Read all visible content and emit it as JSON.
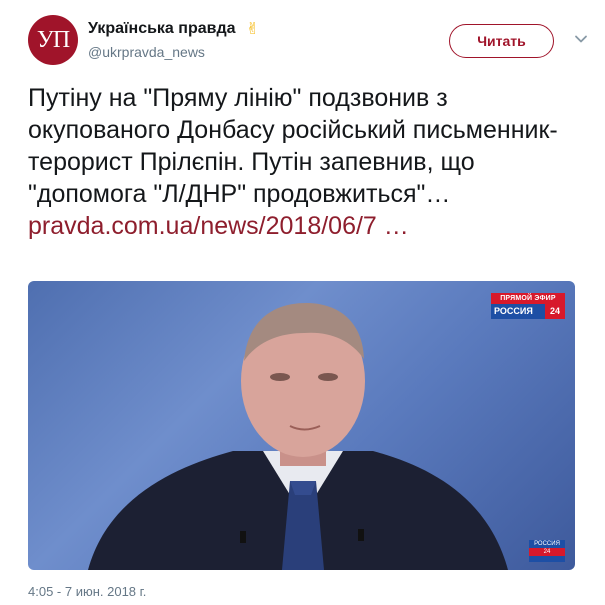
{
  "account": {
    "avatar_text": "УП",
    "display_name": "Українська правда",
    "victory_emoji": "✌",
    "handle": "@ukrpravda_news"
  },
  "follow_button": {
    "label": "Читать"
  },
  "tweet": {
    "text": "Путіну на \"Пряму лінію\" подзвонив з окупованого Донбасу російський письменник-терорист Прілєпін. Путін запевнив, що \"допомога \"Л/ДНР\" продовжиться\"…",
    "link_text": "pravda.com.ua/news/2018/06/7 …"
  },
  "media": {
    "live_label": "ПРЯМОЙ ЭФИР",
    "channel": "РОССИЯ",
    "channel_number": "24",
    "corner_logo_text": "РОССИЯ",
    "corner_logo_sub": "24"
  },
  "timestamp": "4:05 - 7 июн. 2018 г.",
  "colors": {
    "brand": "#a0142a",
    "link": "#8e1e2d",
    "secondary_text": "#657786"
  }
}
